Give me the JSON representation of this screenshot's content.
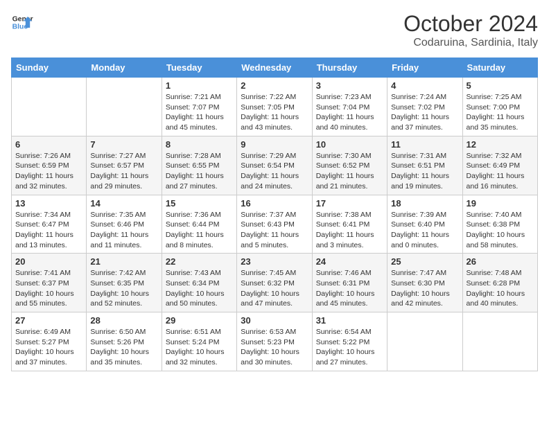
{
  "header": {
    "logo_line1": "General",
    "logo_line2": "Blue",
    "month": "October 2024",
    "location": "Codaruina, Sardinia, Italy"
  },
  "columns": [
    "Sunday",
    "Monday",
    "Tuesday",
    "Wednesday",
    "Thursday",
    "Friday",
    "Saturday"
  ],
  "weeks": [
    [
      {
        "day": "",
        "info": ""
      },
      {
        "day": "",
        "info": ""
      },
      {
        "day": "1",
        "info": "Sunrise: 7:21 AM\nSunset: 7:07 PM\nDaylight: 11 hours and 45 minutes."
      },
      {
        "day": "2",
        "info": "Sunrise: 7:22 AM\nSunset: 7:05 PM\nDaylight: 11 hours and 43 minutes."
      },
      {
        "day": "3",
        "info": "Sunrise: 7:23 AM\nSunset: 7:04 PM\nDaylight: 11 hours and 40 minutes."
      },
      {
        "day": "4",
        "info": "Sunrise: 7:24 AM\nSunset: 7:02 PM\nDaylight: 11 hours and 37 minutes."
      },
      {
        "day": "5",
        "info": "Sunrise: 7:25 AM\nSunset: 7:00 PM\nDaylight: 11 hours and 35 minutes."
      }
    ],
    [
      {
        "day": "6",
        "info": "Sunrise: 7:26 AM\nSunset: 6:59 PM\nDaylight: 11 hours and 32 minutes."
      },
      {
        "day": "7",
        "info": "Sunrise: 7:27 AM\nSunset: 6:57 PM\nDaylight: 11 hours and 29 minutes."
      },
      {
        "day": "8",
        "info": "Sunrise: 7:28 AM\nSunset: 6:55 PM\nDaylight: 11 hours and 27 minutes."
      },
      {
        "day": "9",
        "info": "Sunrise: 7:29 AM\nSunset: 6:54 PM\nDaylight: 11 hours and 24 minutes."
      },
      {
        "day": "10",
        "info": "Sunrise: 7:30 AM\nSunset: 6:52 PM\nDaylight: 11 hours and 21 minutes."
      },
      {
        "day": "11",
        "info": "Sunrise: 7:31 AM\nSunset: 6:51 PM\nDaylight: 11 hours and 19 minutes."
      },
      {
        "day": "12",
        "info": "Sunrise: 7:32 AM\nSunset: 6:49 PM\nDaylight: 11 hours and 16 minutes."
      }
    ],
    [
      {
        "day": "13",
        "info": "Sunrise: 7:34 AM\nSunset: 6:47 PM\nDaylight: 11 hours and 13 minutes."
      },
      {
        "day": "14",
        "info": "Sunrise: 7:35 AM\nSunset: 6:46 PM\nDaylight: 11 hours and 11 minutes."
      },
      {
        "day": "15",
        "info": "Sunrise: 7:36 AM\nSunset: 6:44 PM\nDaylight: 11 hours and 8 minutes."
      },
      {
        "day": "16",
        "info": "Sunrise: 7:37 AM\nSunset: 6:43 PM\nDaylight: 11 hours and 5 minutes."
      },
      {
        "day": "17",
        "info": "Sunrise: 7:38 AM\nSunset: 6:41 PM\nDaylight: 11 hours and 3 minutes."
      },
      {
        "day": "18",
        "info": "Sunrise: 7:39 AM\nSunset: 6:40 PM\nDaylight: 11 hours and 0 minutes."
      },
      {
        "day": "19",
        "info": "Sunrise: 7:40 AM\nSunset: 6:38 PM\nDaylight: 10 hours and 58 minutes."
      }
    ],
    [
      {
        "day": "20",
        "info": "Sunrise: 7:41 AM\nSunset: 6:37 PM\nDaylight: 10 hours and 55 minutes."
      },
      {
        "day": "21",
        "info": "Sunrise: 7:42 AM\nSunset: 6:35 PM\nDaylight: 10 hours and 52 minutes."
      },
      {
        "day": "22",
        "info": "Sunrise: 7:43 AM\nSunset: 6:34 PM\nDaylight: 10 hours and 50 minutes."
      },
      {
        "day": "23",
        "info": "Sunrise: 7:45 AM\nSunset: 6:32 PM\nDaylight: 10 hours and 47 minutes."
      },
      {
        "day": "24",
        "info": "Sunrise: 7:46 AM\nSunset: 6:31 PM\nDaylight: 10 hours and 45 minutes."
      },
      {
        "day": "25",
        "info": "Sunrise: 7:47 AM\nSunset: 6:30 PM\nDaylight: 10 hours and 42 minutes."
      },
      {
        "day": "26",
        "info": "Sunrise: 7:48 AM\nSunset: 6:28 PM\nDaylight: 10 hours and 40 minutes."
      }
    ],
    [
      {
        "day": "27",
        "info": "Sunrise: 6:49 AM\nSunset: 5:27 PM\nDaylight: 10 hours and 37 minutes."
      },
      {
        "day": "28",
        "info": "Sunrise: 6:50 AM\nSunset: 5:26 PM\nDaylight: 10 hours and 35 minutes."
      },
      {
        "day": "29",
        "info": "Sunrise: 6:51 AM\nSunset: 5:24 PM\nDaylight: 10 hours and 32 minutes."
      },
      {
        "day": "30",
        "info": "Sunrise: 6:53 AM\nSunset: 5:23 PM\nDaylight: 10 hours and 30 minutes."
      },
      {
        "day": "31",
        "info": "Sunrise: 6:54 AM\nSunset: 5:22 PM\nDaylight: 10 hours and 27 minutes."
      },
      {
        "day": "",
        "info": ""
      },
      {
        "day": "",
        "info": ""
      }
    ]
  ]
}
